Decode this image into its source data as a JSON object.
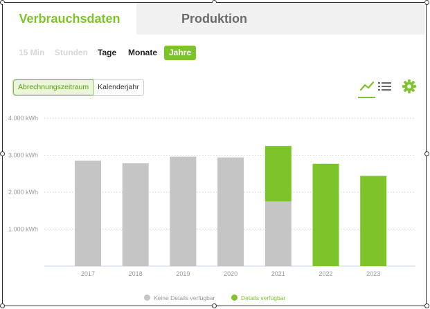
{
  "tabs": {
    "active": "Verbrauchsdaten",
    "inactive": "Produktion"
  },
  "periods": [
    "15 Min",
    "Stunden",
    "Tage",
    "Monate",
    "Jahre"
  ],
  "periods_selected": "Jahre",
  "range_toggle": {
    "selected": "Abrechnungszeitraum",
    "other": "Kalenderjahr"
  },
  "icons": [
    "line-chart-icon",
    "list-icon",
    "gear-icon"
  ],
  "colors": {
    "accent": "#7dc42a",
    "grey": "#c5c5c5"
  },
  "chart_data": {
    "type": "bar",
    "categories": [
      "2017",
      "2018",
      "2019",
      "2020",
      "2021",
      "2022",
      "2023"
    ],
    "series": [
      {
        "name": "Keine Details verfügbar",
        "values": [
          2850,
          2780,
          2960,
          2940,
          1750,
          0,
          0
        ]
      },
      {
        "name": "Details verfügbar",
        "values": [
          0,
          0,
          0,
          0,
          1500,
          2770,
          2440
        ]
      }
    ],
    "y_ticks": [
      "1.000 kWh",
      "2.000 kWh",
      "3.000 kWh",
      "4.000 kWh"
    ],
    "y_tick_values": [
      1000,
      2000,
      3000,
      4000
    ],
    "ylim": [
      0,
      4000
    ],
    "grid": true,
    "legend_position": "bottom-center"
  }
}
